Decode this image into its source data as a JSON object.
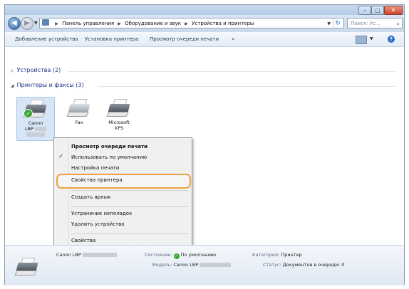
{
  "window": {
    "controls": {
      "minimize": "–",
      "maximize": "□",
      "close": "✕"
    }
  },
  "address": {
    "crumbs": [
      "Панель управления",
      "Оборудование и звук",
      "Устройства и принтеры"
    ],
    "search_placeholder": "Поиск: Ус...",
    "refresh_glyph": "↻",
    "search_glyph": "⌕"
  },
  "toolbar": {
    "add_device": "Добавление устройства",
    "install_printer": "Установка принтера",
    "view_queue": "Просмотр очереди печати",
    "more": "»",
    "help": "?"
  },
  "groups": {
    "devices": {
      "label": "Устройства (2)",
      "expanded": false
    },
    "printers": {
      "label": "Принтеры и факсы (3)",
      "expanded": true
    }
  },
  "printers": [
    {
      "name_line1": "Canon",
      "name_line2": "LBP",
      "default": true,
      "selected": true,
      "redacted": true
    },
    {
      "name_line1": "Fax",
      "name_line2": "",
      "default": false,
      "selected": false
    },
    {
      "name_line1": "Microsoft",
      "name_line2": "XPS",
      "default": false,
      "selected": false
    }
  ],
  "context_menu": {
    "items": [
      {
        "label": "Просмотр очереди печати",
        "bold": true,
        "checked": false
      },
      {
        "label": "Использовать по умолчанию",
        "bold": false,
        "checked": true
      },
      {
        "label": "Настройка печати",
        "bold": false,
        "checked": false
      },
      {
        "label": "Свойства принтера",
        "bold": false,
        "checked": false,
        "highlighted": true
      },
      {
        "label": "Создать ярлык",
        "bold": false,
        "checked": false
      },
      {
        "label": "Устранение неполадок",
        "bold": false,
        "checked": false
      },
      {
        "label": "Удалить устройство",
        "bold": false,
        "checked": false
      },
      {
        "label": "Свойства",
        "bold": false,
        "checked": false
      }
    ],
    "check_glyph": "✓",
    "highlight_color": "#f0a044"
  },
  "details": {
    "name": "Canon LBP",
    "state_label": "Состояние:",
    "state_value": "По умолчанию",
    "category_label": "Категория:",
    "category_value": "Принтер",
    "model_label": "Модель:",
    "model_value": "Canon LBP",
    "status_label": "Статус:",
    "status_value": "Документов в очереди: 0"
  }
}
